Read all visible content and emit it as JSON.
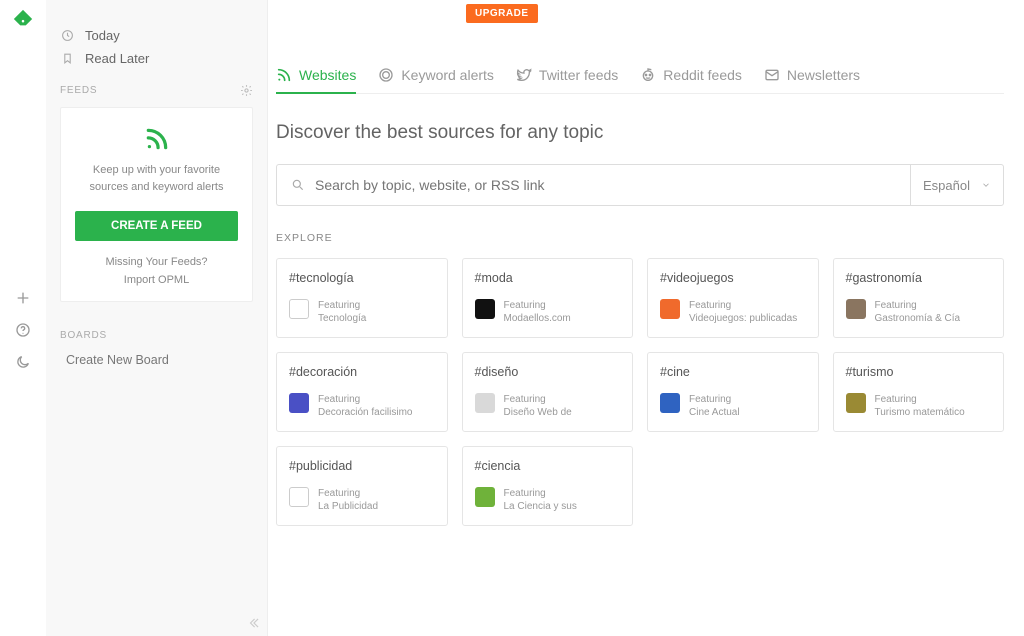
{
  "rail": {},
  "sidebar": {
    "today": "Today",
    "read_later": "Read Later",
    "feeds_label": "FEEDS",
    "feeds_msg": "Keep up with your favorite sources and keyword alerts",
    "create_feed": "CREATE A FEED",
    "missing": "Missing Your Feeds?",
    "import": "Import OPML",
    "boards_label": "BOARDS",
    "create_board": "Create New Board"
  },
  "topbar": {
    "upgrade": "UPGRADE"
  },
  "tabs": [
    {
      "label": "Websites",
      "active": true
    },
    {
      "label": "Keyword alerts"
    },
    {
      "label": "Twitter feeds"
    },
    {
      "label": "Reddit feeds"
    },
    {
      "label": "Newsletters"
    }
  ],
  "headline": "Discover the best sources for any topic",
  "search": {
    "placeholder": "Search by topic, website, or RSS link"
  },
  "lang": {
    "selected": "Español"
  },
  "explore_label": "EXPLORE",
  "cards": [
    {
      "tag": "#tecnología",
      "featuring": "Featuring",
      "sub": "Tecnología",
      "color": "#ffffff"
    },
    {
      "tag": "#moda",
      "featuring": "Featuring",
      "sub": "Modaellos.com",
      "color": "#111111"
    },
    {
      "tag": "#videojuegos",
      "featuring": "Featuring",
      "sub": "Videojuegos: publicadas",
      "color": "#f06a2c"
    },
    {
      "tag": "#gastronomía",
      "featuring": "Featuring",
      "sub": "Gastronomía & Cía",
      "color": "#8a7560"
    },
    {
      "tag": "#decoración",
      "featuring": "Featuring",
      "sub": "Decoración facilisimo",
      "color": "#4a50c5"
    },
    {
      "tag": "#diseño",
      "featuring": "Featuring",
      "sub": "Diseño Web de",
      "color": "#d9d9d9"
    },
    {
      "tag": "#cine",
      "featuring": "Featuring",
      "sub": "Cine Actual",
      "color": "#2f63c1"
    },
    {
      "tag": "#turismo",
      "featuring": "Featuring",
      "sub": "Turismo matemático",
      "color": "#9a8a34"
    },
    {
      "tag": "#publicidad",
      "featuring": "Featuring",
      "sub": "La Publicidad",
      "color": "#ffffff"
    },
    {
      "tag": "#ciencia",
      "featuring": "Featuring",
      "sub": "La Ciencia y sus",
      "color": "#6fb23a"
    }
  ]
}
